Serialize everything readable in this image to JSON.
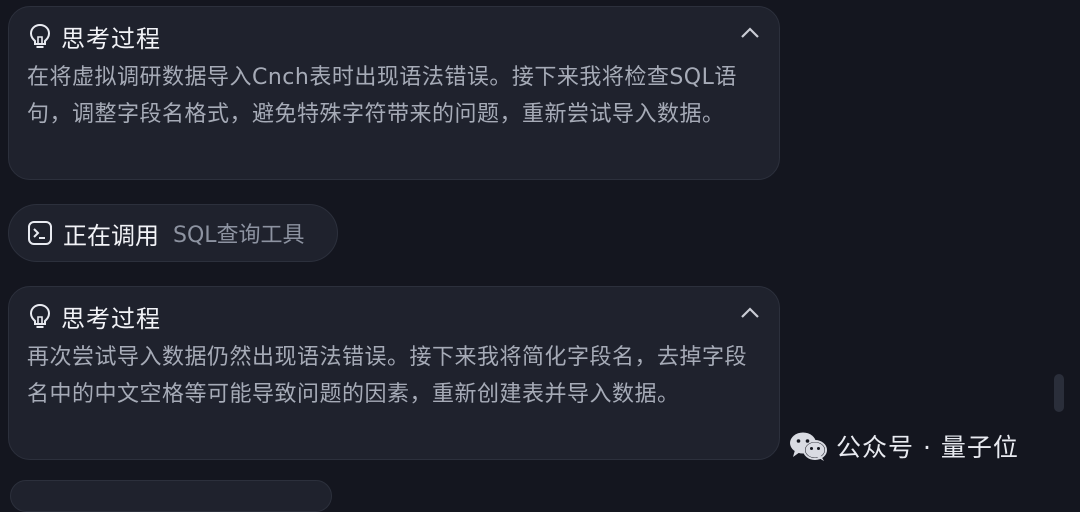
{
  "cards": [
    {
      "title": "思考过程",
      "body": "在将虚拟调研数据导入Cnch表时出现语法错误。接下来我将检查SQL语句，调整字段名格式，避免特殊字符带来的问题，重新尝试导入数据。",
      "icon": "lightbulb-icon"
    },
    {
      "title": "思考过程",
      "body": "再次尝试导入数据仍然出现语法错误。接下来我将简化字段名，去掉字段名中的中文空格等可能导致问题的因素，重新创建表并导入数据。",
      "icon": "lightbulb-icon"
    }
  ],
  "tool_call": {
    "label": "正在调用",
    "tool": "SQL查询工具",
    "icon": "terminal-icon"
  },
  "watermark": {
    "text": "公众号 · 量子位",
    "icon": "wechat-icon"
  },
  "colors": {
    "background": "#14161f",
    "card": "#1f222d",
    "title": "#f2f3f7",
    "body": "#a6abb7"
  }
}
